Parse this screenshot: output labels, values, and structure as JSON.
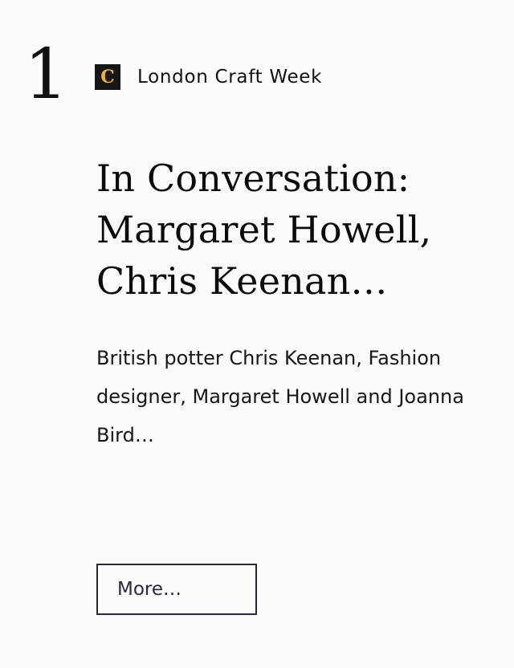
{
  "rank": "1",
  "source": {
    "logo_letter": "C",
    "name": "London Craft Week"
  },
  "article": {
    "title": "In Conversation: Margaret Howell, Chris Keenan…",
    "summary": "British potter Chris Keenan, Fashion designer, Margaret Howell and Joanna Bird…"
  },
  "actions": {
    "more_label": "More…"
  },
  "colors": {
    "logo_background": "#151515",
    "logo_letter": "#f1b321",
    "button_border": "#2a2741",
    "text": "#111111",
    "background": "#fbfbfc"
  }
}
